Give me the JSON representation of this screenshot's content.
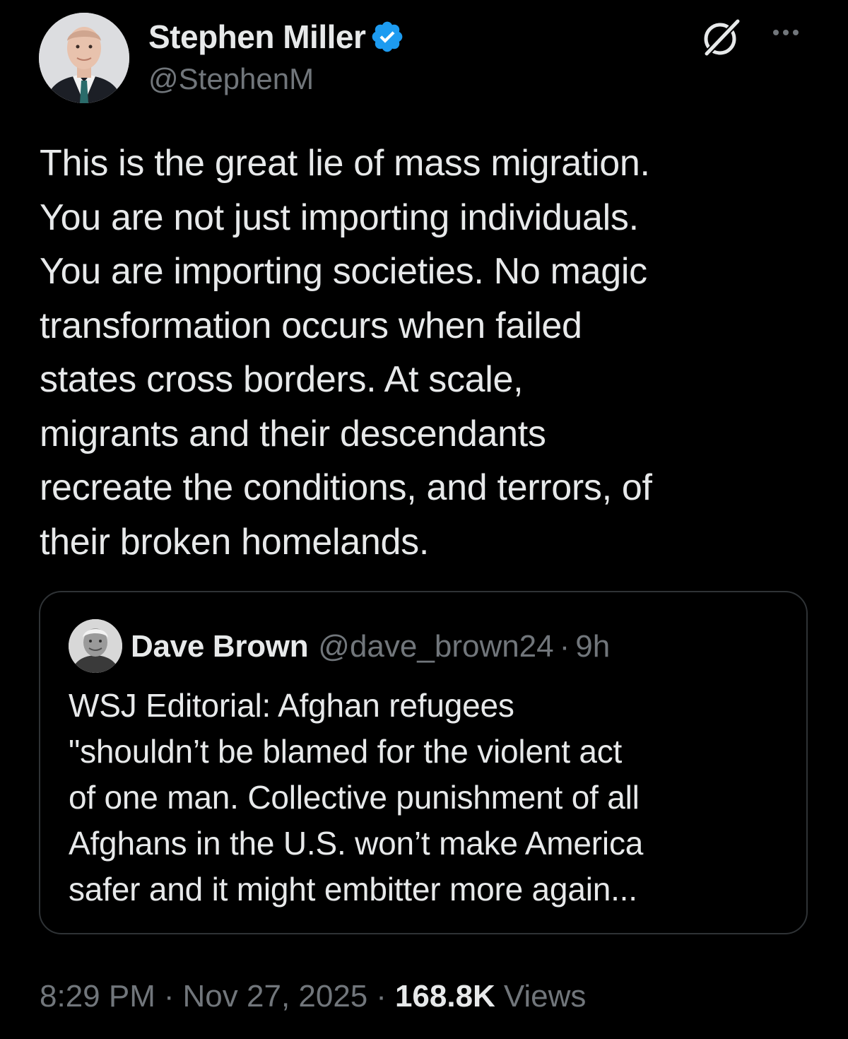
{
  "author": {
    "display_name": "Stephen Miller",
    "handle": "@StephenM",
    "verified": true,
    "verified_color": "#1d9bf0"
  },
  "icons": {
    "grok": "grok-icon",
    "more": "more-dots-icon",
    "verified": "verified-badge-icon"
  },
  "tweet": {
    "lines": [
      "This is the great lie of mass migration.",
      "You are not just importing individuals.",
      "You are importing societies. No magic",
      "transformation occurs when failed",
      "states cross borders. At scale,",
      "migrants and their descendants",
      "recreate the conditions, and terrors, of",
      "their broken homelands."
    ]
  },
  "quote": {
    "display_name": "Dave Brown",
    "handle": "@dave_brown24",
    "separator": "·",
    "time": "9h",
    "lines": [
      "WSJ Editorial: Afghan refugees",
      "\"shouldn’t be blamed for the violent act",
      "of one man. Collective punishment of all",
      "Afghans in the U.S. won’t make America",
      "safer and it might embitter more again..."
    ]
  },
  "meta": {
    "time": "8:29 PM",
    "separator": "·",
    "date": "Nov 27, 2025",
    "views_count": "168.8K",
    "views_label": "Views"
  },
  "colors": {
    "background": "#000000",
    "text_primary": "#e7e9ea",
    "text_secondary": "#71767b",
    "border": "#2f3336"
  }
}
